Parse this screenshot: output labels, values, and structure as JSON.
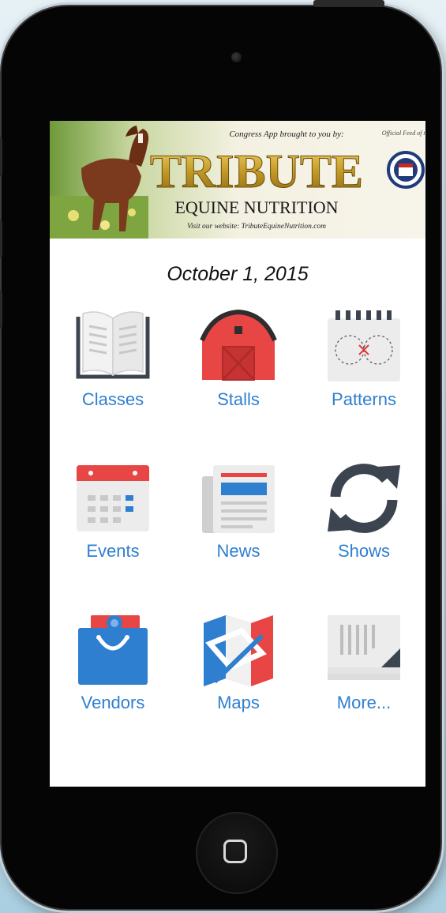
{
  "banner": {
    "tagline": "Congress App brought to you by:",
    "brand": "TRIBUTE",
    "subtitle": "EQUINE NUTRITION",
    "website": "Visit our website: TributeEquineNutrition.com",
    "official": "Official Feed of the"
  },
  "date": "October 1, 2015",
  "menu": [
    {
      "label": "Classes",
      "icon": "open-book-icon"
    },
    {
      "label": "Stalls",
      "icon": "barn-icon"
    },
    {
      "label": "Patterns",
      "icon": "pattern-notepad-icon"
    },
    {
      "label": "Events",
      "icon": "calendar-icon"
    },
    {
      "label": "News",
      "icon": "newspaper-icon"
    },
    {
      "label": "Shows",
      "icon": "refresh-icon"
    },
    {
      "label": "Vendors",
      "icon": "shopping-bag-icon"
    },
    {
      "label": "Maps",
      "icon": "folded-map-icon"
    },
    {
      "label": "More...",
      "icon": "documents-icon"
    }
  ],
  "colors": {
    "label_blue": "#2f7fd0",
    "barn_red": "#e84545",
    "icon_dark": "#3c4450",
    "gold": "#c49a26"
  }
}
